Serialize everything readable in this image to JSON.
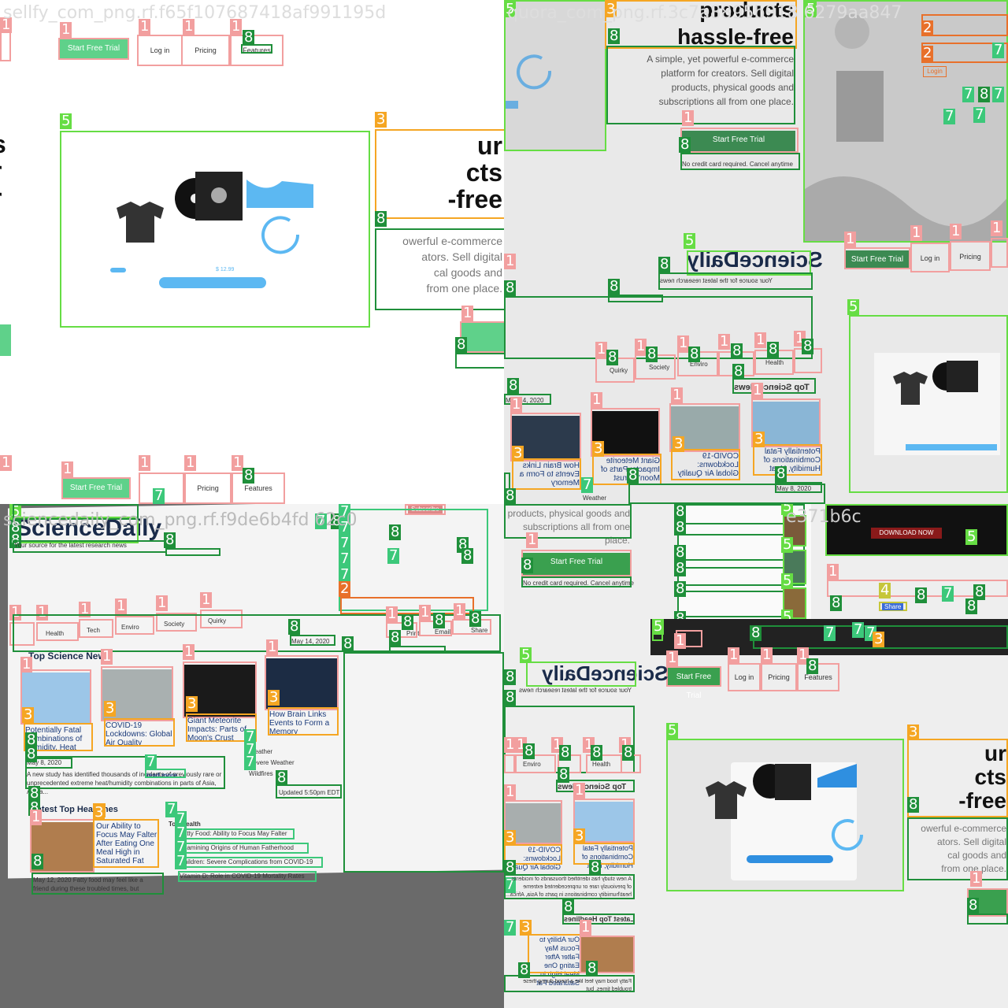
{
  "quadrants": {
    "q1_title": "sellfy_com_png.rf.f65f107687418af991195d",
    "q2_title": "quora_com_png.rf.3c7a8895b918 6279aa847",
    "q3_title": "sciencedaily_com_png.rf.f9de6b4fd 62c0",
    "q4_title": "e371b6c"
  },
  "sellfy": {
    "start_free_trial": "Start Free Trial",
    "log_in": "Log in",
    "pricing": "Pricing",
    "features": "Features",
    "hero_title_lines": [
      "ur",
      "cts",
      "-free"
    ],
    "hero_text_lines": [
      "owerful e-commerce",
      "ators. Sell digital",
      "cal goods and",
      "from one place."
    ],
    "price_label": "$ 12.99",
    "second_hero_title": [
      "products",
      "hassle-free"
    ],
    "second_hero_text": [
      "A simple, yet powerful e-commerce",
      "platform for creators. Sell digital",
      "products, physical goods and",
      "subscriptions all from one place."
    ],
    "no_card": "No credit card required. Cancel anytime"
  },
  "sciencedaily": {
    "logo_text": "ScienceDaily",
    "tagline": "Your source for the latest research news",
    "nav_items": [
      "Health",
      "Tech",
      "Enviro",
      "Society",
      "Quirky"
    ],
    "top_science_news": "Top Science News",
    "latest_top_headlines": "Latest Top Headlines",
    "date1": "May 14, 2020",
    "date2": "May 8, 2020",
    "date3": "May 12, 2020",
    "updated": "Updated 5:50pm EDT",
    "subscribe": "Subscribe",
    "print": "Print",
    "email": "Email",
    "share": "Share",
    "read_more": "read more",
    "cards": [
      "Potentially Fatal Combinations of Humidity, Heat",
      "COVID-19 Lockdowns: Global Air Quality",
      "Giant Meteorite Impacts: Parts of Moon's Crust",
      "How Brain Links Events to Form a Memory"
    ],
    "article_snippet": "A new study has identified thousands of incidents of previously rare or unprecedented extreme heat/humidity combinations in parts of Asia, Africa...",
    "headline_card": "Our Ability to Focus May Falter After Eating One Meal High in Saturated Fat",
    "headline_snippet": "Fatty food may feel like a friend during these troubled times, but",
    "health_links": [
      "Fatty Food: Ability to Focus May Falter",
      "Examining Origins of Human Fatherhood",
      "Children: Severe Complications from COVID-19",
      "Vitamin D: Role in COVID-19 Mortality Rates"
    ],
    "side_links": [
      "Weather",
      "Severe Weather",
      "Wildfires"
    ],
    "top_health": "Top Health"
  },
  "misc": {
    "download_now": "DOWNLOAD NOW",
    "share": "Share",
    "login": "Login",
    "label_1": "1",
    "label_2": "2",
    "label_3": "3",
    "label_4": "4",
    "label_5": "5",
    "label_7": "7",
    "label_8": "8"
  }
}
